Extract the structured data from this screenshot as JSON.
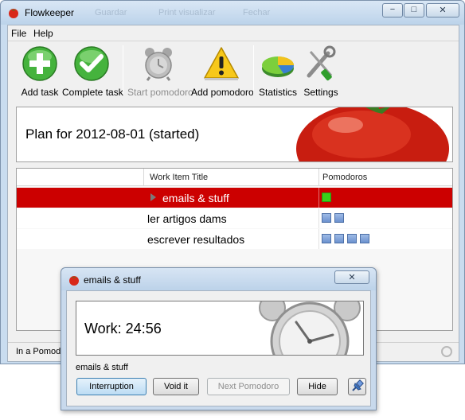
{
  "window": {
    "title": "Flowkeeper",
    "ghost_tabs": [
      "Guardar",
      "Print visualizar",
      "Fechar"
    ],
    "minimize_glyph": "−",
    "maximize_glyph": "□",
    "close_glyph": "✕"
  },
  "menu": {
    "items": [
      "File",
      "Help"
    ]
  },
  "toolbar": {
    "add_task": {
      "label": "Add task",
      "icon": "add-icon"
    },
    "complete_task": {
      "label": "Complete task",
      "icon": "check-icon"
    },
    "start_pomodoro": {
      "label": "Start pomodoro",
      "icon": "alarm-clock-icon",
      "enabled": false
    },
    "add_pomodoro": {
      "label": "Add pomodoro",
      "icon": "warning-icon"
    },
    "statistics": {
      "label": "Statistics",
      "icon": "pie-chart-icon"
    },
    "settings": {
      "label": "Settings",
      "icon": "tools-icon"
    }
  },
  "plan": {
    "title": "Plan for 2012-08-01 (started)"
  },
  "table": {
    "columns": [
      "",
      "Work Item Title",
      "Pomodoros"
    ],
    "rows": [
      {
        "title": "emails & stuff",
        "selected": true,
        "pomodoros": 1,
        "completed": 1
      },
      {
        "title": "ler artigos dams",
        "selected": false,
        "pomodoros": 2,
        "completed": 0
      },
      {
        "title": "escrever resultados",
        "selected": false,
        "pomodoros": 4,
        "completed": 0
      }
    ]
  },
  "status": {
    "text": "In a Pomodoro"
  },
  "popup": {
    "title": "emails & stuff",
    "close_glyph": "✕",
    "timer": "Work: 24:56",
    "task": "emails & stuff",
    "buttons": {
      "interruption": "Interruption",
      "void": "Void it",
      "next": "Next Pomodoro",
      "hide": "Hide"
    }
  },
  "colors": {
    "selection": "#cc0000",
    "pomodoro_done": "#39d119",
    "pomodoro_pending": "#7fa2d8",
    "window_frame": "#c9dcef"
  }
}
